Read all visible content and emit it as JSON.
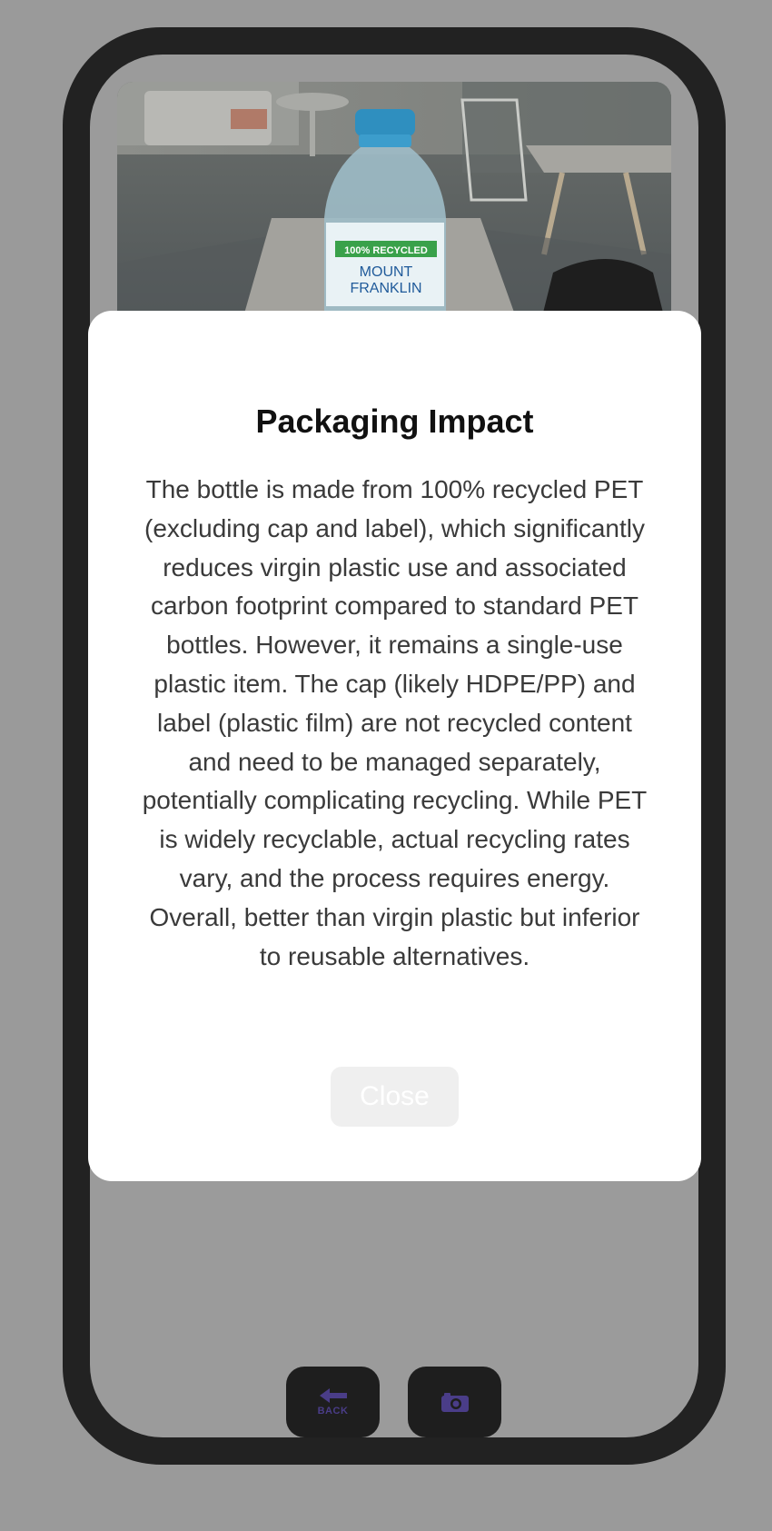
{
  "modal": {
    "title": "Packaging Impact",
    "body": "The bottle is made from 100% recycled PET (excluding cap and label), which significantly reduces virgin plastic use and associated carbon footprint compared to standard PET bottles. However, it remains a single-use plastic item. The cap (likely HDPE/PP) and label (plastic film) are not recycled content and need to be managed separately, potentially complicating recycling. While PET is widely recyclable, actual recycling rates vary, and the process requires energy. Overall, better than virgin plastic but inferior to reusable alternatives.",
    "close_label": "Close"
  },
  "photo": {
    "label_top": "100% RECYCLED",
    "brand_line1": "MOUNT",
    "brand_line2": "FRANKLIN"
  },
  "bottom_bar": {
    "back_label": "BACK"
  },
  "icons": {
    "back": "back-arrow-icon",
    "camera": "camera-icon"
  },
  "colors": {
    "overlay": "#9a9a9a",
    "phone_frame": "#222222",
    "accent": "#4a3d88",
    "modal": "#ffffff"
  }
}
